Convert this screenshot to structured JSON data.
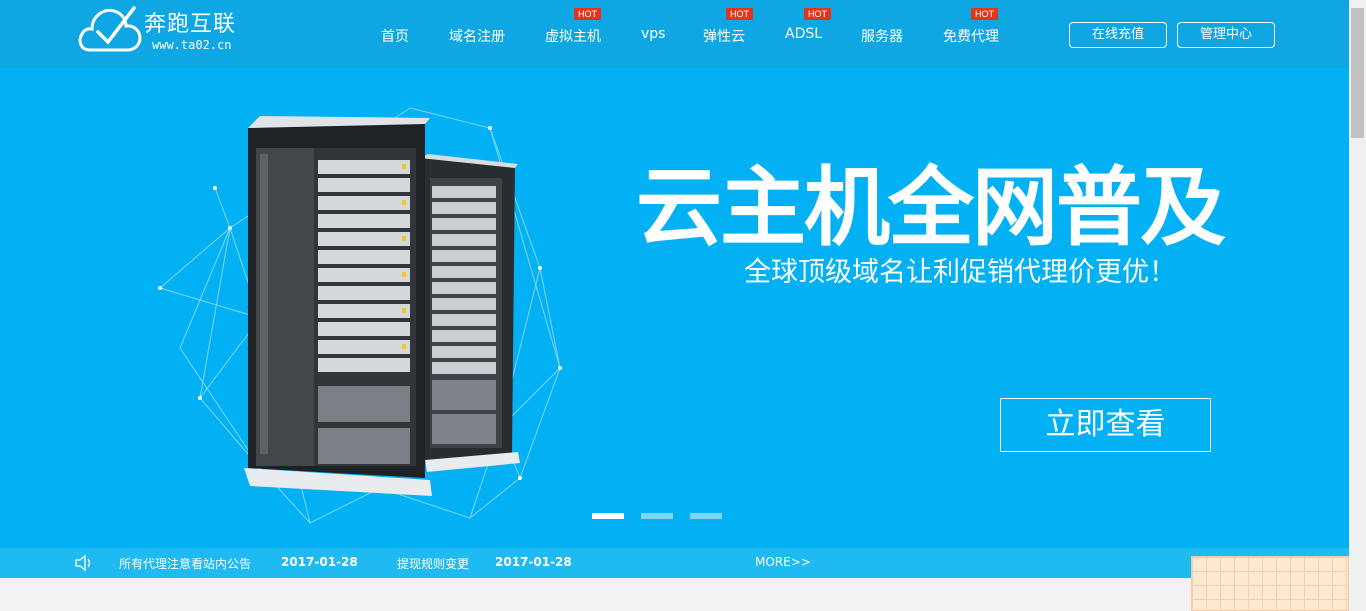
{
  "brand": {
    "name": "奔跑互联",
    "url": "www.ta02.cn"
  },
  "nav": {
    "items": [
      {
        "label": "首页",
        "hot": ""
      },
      {
        "label": "域名注册",
        "hot": ""
      },
      {
        "label": "虚拟主机",
        "hot": "HOT"
      },
      {
        "label": "vps",
        "hot": ""
      },
      {
        "label": "弹性云",
        "hot": "HOT"
      },
      {
        "label": "ADSL",
        "hot": "HOT"
      },
      {
        "label": "服务器",
        "hot": ""
      },
      {
        "label": "免费代理",
        "hot": "HOT"
      }
    ],
    "recharge": "在线充值",
    "admin": "管理中心"
  },
  "banner": {
    "headline": "云主机全网普及",
    "subline": "全球顶级域名让利促销代理价更优！",
    "cta": "立即查看",
    "slides": 3,
    "active_slide": 1
  },
  "notices": {
    "items": [
      {
        "title": "所有代理注意看站内公告",
        "date": "2017-01-28"
      },
      {
        "title": "提现规则变更",
        "date": "2017-01-28"
      }
    ],
    "more": "MORE>>"
  },
  "colors": {
    "header": "#0ea7e4",
    "hero": "#02b0f4",
    "notice_bar": "#1fbaf2",
    "hot_badge": "#e2361c"
  },
  "icons": {
    "logo": "cloud-check-icon",
    "notice": "speaker-icon"
  }
}
